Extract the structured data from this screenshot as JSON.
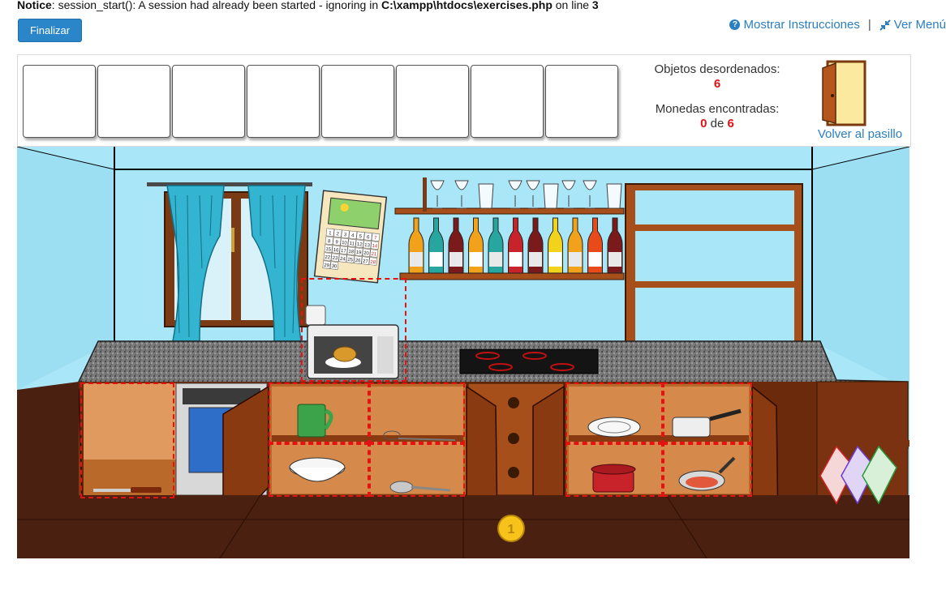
{
  "notice": {
    "label": "Notice",
    "message": ": session_start(): A session had already been started - ignoring in ",
    "path": "C:\\xampp\\htdocs\\exercises.php",
    "line_text": " on line ",
    "line": "3"
  },
  "toolbar": {
    "finalize_label": "Finalizar",
    "instructions_label": "Mostrar Instrucciones",
    "separator": "|",
    "menu_label": "Ver Menú"
  },
  "hud": {
    "slots_count": 8,
    "disorder_label": "Objetos desordenados:",
    "disorder_count": "6",
    "coins_label": "Monedas encontradas:",
    "coins_found": "0",
    "coins_of": "de",
    "coins_total": "6",
    "back_label": "Volver al pasillo"
  },
  "calendar": {
    "days": [
      "1",
      "2",
      "3",
      "4",
      "5",
      "6",
      "7",
      "8",
      "9",
      "10",
      "11",
      "12",
      "13",
      "14",
      "15",
      "16",
      "17",
      "18",
      "19",
      "20",
      "21",
      "22",
      "23",
      "24",
      "25",
      "26",
      "27",
      "28",
      "29",
      "30"
    ]
  },
  "coin": {
    "value": "1"
  },
  "colors": {
    "wall": "#a9e6f7",
    "floor": "#4a2010",
    "cabinet": "#8a3a10",
    "accent_blue": "#2a86c9",
    "hotspot": "#e81111"
  }
}
